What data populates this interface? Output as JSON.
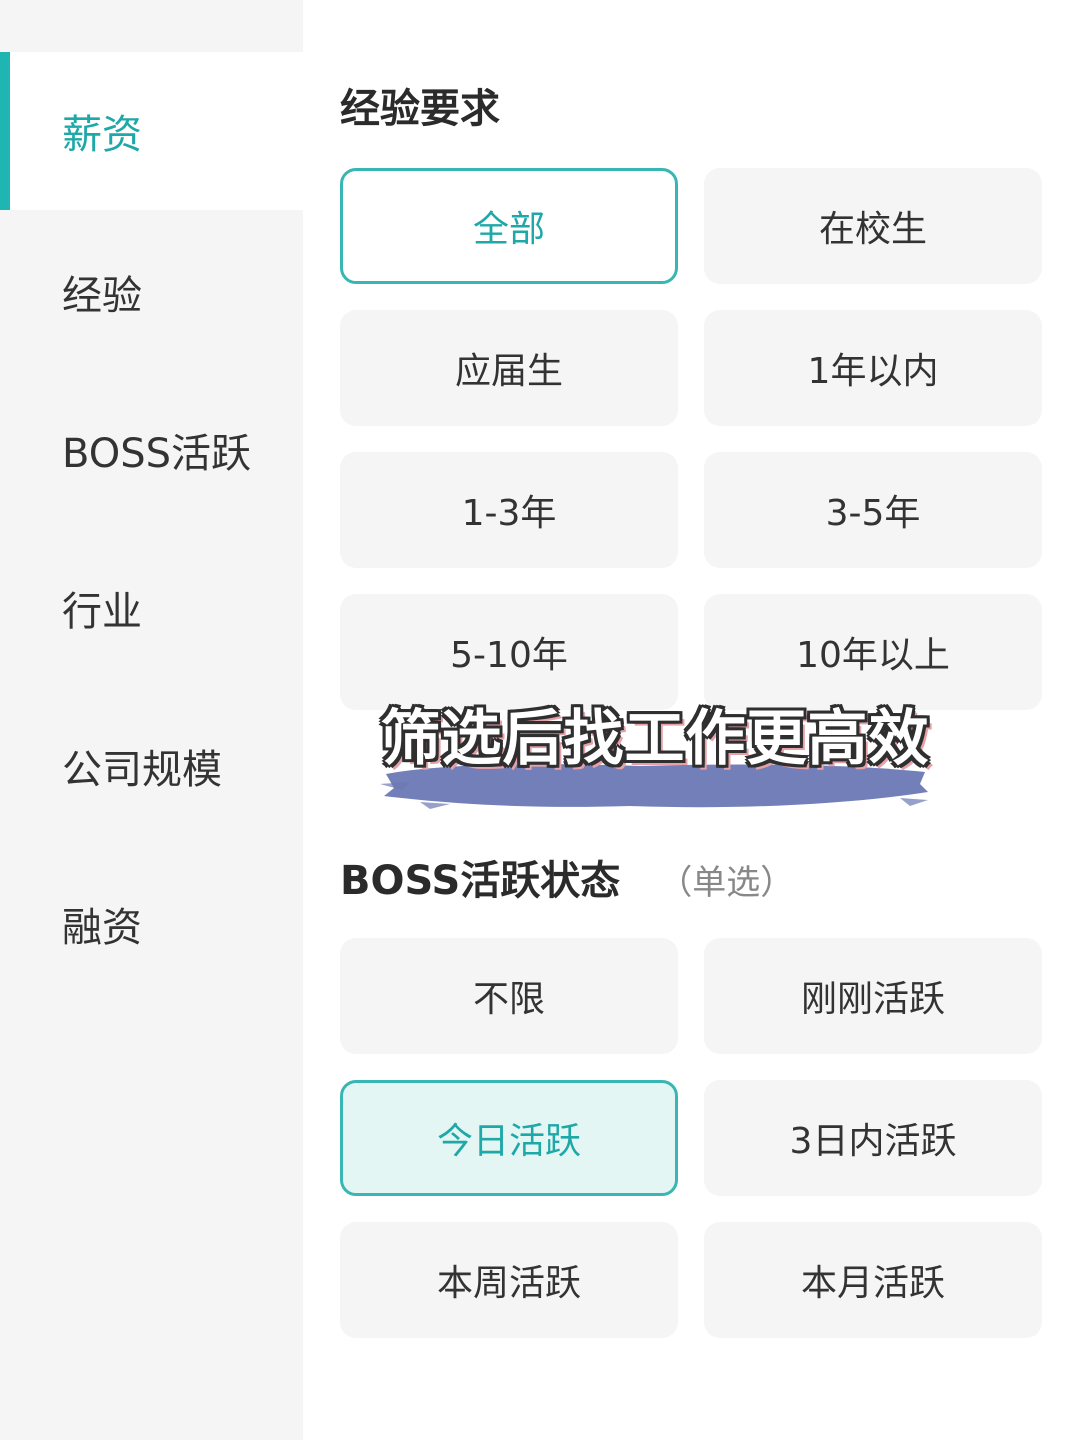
{
  "sidebar": {
    "items": [
      {
        "label": "薪资",
        "active": true
      },
      {
        "label": "经验",
        "active": false
      },
      {
        "label": "BOSS活跃",
        "active": false
      },
      {
        "label": "行业",
        "active": false
      },
      {
        "label": "公司规模",
        "active": false
      },
      {
        "label": "融资",
        "active": false
      }
    ]
  },
  "experience": {
    "title": "经验要求",
    "options": [
      "全部",
      "在校生",
      "应届生",
      "1年以内",
      "1-3年",
      "3-5年",
      "5-10年",
      "10年以上"
    ],
    "selected": "全部"
  },
  "boss_active": {
    "title": "BOSS活跃状态",
    "subtitle": "（单选）",
    "options": [
      "不限",
      "刚刚活跃",
      "今日活跃",
      "3日内活跃",
      "本周活跃",
      "本月活跃"
    ],
    "selected": "今日活跃"
  },
  "overlay": {
    "caption": "筛选后找工作更高效"
  },
  "colors": {
    "accent": "#1fa8a8",
    "selected_bg": "#e4f6f4",
    "option_bg": "#f5f5f5",
    "sidebar_bg": "#f5f5f5",
    "brush": "#6b78b4"
  }
}
